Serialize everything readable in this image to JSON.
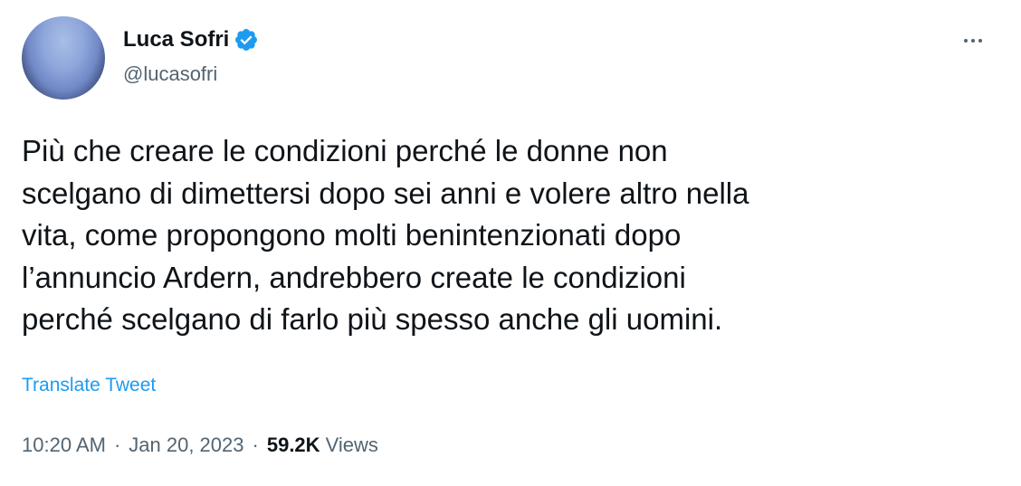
{
  "author": {
    "name": "Luca Sofri",
    "handle": "@lucasofri",
    "verified": true
  },
  "tweet": {
    "text": "Più che creare le condizioni perché le donne non\nscelgano di dimettersi dopo sei anni e volere altro nella\nvita, come propongono molti benintenzionati dopo\nl’annuncio Ardern, andrebbero create le condizioni\nperché scelgano di farlo più spesso anche gli uomini.",
    "translate_label": "Translate Tweet"
  },
  "meta": {
    "time": "10:20 AM",
    "separator": "·",
    "date": "Jan 20, 2023",
    "views_count": "59.2K",
    "views_label": "Views"
  },
  "icons": {
    "verified": "verified-badge-icon",
    "more": "more-options-icon"
  },
  "colors": {
    "accent": "#1d9bf0",
    "text": "#0f1419",
    "secondary": "#536471"
  }
}
